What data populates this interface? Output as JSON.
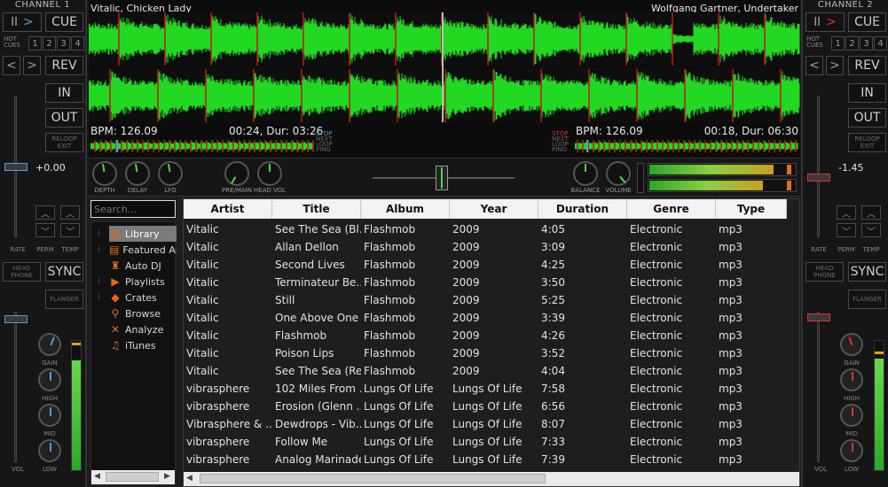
{
  "channels": {
    "left": {
      "title": "CHANNEL 1",
      "play_icon": "II",
      "cue_label": "CUE",
      "hot_label": "HOT\nCUES",
      "hot_cues": [
        "1",
        "2",
        "3",
        "4"
      ],
      "rev_label": "REV",
      "in_label": "IN",
      "out_label": "OUT",
      "reloop_label": "RELOOP\nEXIT",
      "rate_value": "+0.00",
      "rate_label": "RATE",
      "perm_label": "PERM",
      "temp_label": "TEMP",
      "headphone_label": "HEAD\nPHONE",
      "sync_label": "SYNC",
      "flanger_label": "FLANGER",
      "gain_label": "GAIN",
      "high_label": "HIGH",
      "mid_label": "MID",
      "low_label": "LOW",
      "vol_label": "VOL"
    },
    "right": {
      "title": "CHANNEL 2",
      "play_icon": "II",
      "cue_label": "CUE",
      "hot_label": "HOT\nCUES",
      "hot_cues": [
        "1",
        "2",
        "3",
        "4"
      ],
      "rev_label": "REV",
      "in_label": "IN",
      "out_label": "OUT",
      "reloop_label": "RELOOP\nEXIT",
      "rate_value": "-1.45",
      "rate_label": "RATE",
      "perm_label": "PERM",
      "temp_label": "TEMP",
      "headphone_label": "HEAD\nPHONE",
      "sync_label": "SYNC",
      "flanger_label": "FLANGER",
      "gain_label": "GAIN",
      "high_label": "HIGH",
      "mid_label": "MID",
      "low_label": "LOW",
      "vol_label": "VOL"
    }
  },
  "deck1": {
    "track": "Vitalic, Chicken Lady",
    "bpm": "BPM: 126.09",
    "time": "00:24, Dur: 03:26",
    "status": [
      "STOP",
      "NEXT",
      "LOOP",
      "PING"
    ]
  },
  "deck2": {
    "track": "Wolfgang Gartner, Undertaker",
    "bpm": "BPM: 126.09",
    "time": "00:18, Dur: 06:30",
    "status": [
      "STOP",
      "NEXT",
      "LOOP",
      "PING"
    ]
  },
  "mixer": {
    "knobs_left": [
      "DEPTH",
      "DELAY",
      "LFO",
      "PRE/MAIN",
      "HEAD VOL"
    ],
    "knobs_right": [
      "BALANCE",
      "VOLUME"
    ]
  },
  "library": {
    "search_placeholder": "Search...",
    "tree": [
      {
        "label": "Library",
        "icon": "library-icon",
        "glyph": "▥"
      },
      {
        "label": "Featured Artists",
        "icon": "featured-icon",
        "glyph": "▤"
      },
      {
        "label": "Auto DJ",
        "icon": "robot-icon",
        "glyph": "♜"
      },
      {
        "label": "Playlists",
        "icon": "playlist-icon",
        "glyph": "▶"
      },
      {
        "label": "Crates",
        "icon": "crate-icon",
        "glyph": "◆"
      },
      {
        "label": "Browse",
        "icon": "browse-icon",
        "glyph": "⚲"
      },
      {
        "label": "Analyze",
        "icon": "analyze-icon",
        "glyph": "✕"
      },
      {
        "label": "iTunes",
        "icon": "itunes-icon",
        "glyph": "♫"
      }
    ],
    "columns": [
      "Artist",
      "Title",
      "Album",
      "Year",
      "Duration",
      "Genre",
      "Type"
    ],
    "rows": [
      [
        "Vitalic",
        "See The Sea (Bl...",
        "Flashmob",
        "2009",
        "4:05",
        "Electronic",
        "mp3"
      ],
      [
        "Vitalic",
        "Allan Dellon",
        "Flashmob",
        "2009",
        "3:09",
        "Electronic",
        "mp3"
      ],
      [
        "Vitalic",
        "Second Lives",
        "Flashmob",
        "2009",
        "4:25",
        "Electronic",
        "mp3"
      ],
      [
        "Vitalic",
        "Terminateur Be...",
        "Flashmob",
        "2009",
        "3:50",
        "Electronic",
        "mp3"
      ],
      [
        "Vitalic",
        "Still",
        "Flashmob",
        "2009",
        "5:25",
        "Electronic",
        "mp3"
      ],
      [
        "Vitalic",
        "One Above One",
        "Flashmob",
        "2009",
        "3:39",
        "Electronic",
        "mp3"
      ],
      [
        "Vitalic",
        "Flashmob",
        "Flashmob",
        "2009",
        "4:26",
        "Electronic",
        "mp3"
      ],
      [
        "Vitalic",
        "Poison Lips",
        "Flashmob",
        "2009",
        "3:52",
        "Electronic",
        "mp3"
      ],
      [
        "Vitalic",
        "See The Sea (Red)",
        "Flashmob",
        "2009",
        "4:04",
        "Electronic",
        "mp3"
      ],
      [
        "vibrasphere",
        "102 Miles From ...",
        "Lungs Of Life",
        "Lungs Of Life",
        "7:58",
        "Electronic",
        "mp3"
      ],
      [
        "vibrasphere",
        "Erosion (Glenn ...",
        "Lungs Of Life",
        "Lungs Of Life",
        "6:56",
        "Electronic",
        "mp3"
      ],
      [
        "Vibrasphere & ...",
        "Dewdrops - Vib...",
        "Lungs Of Life",
        "Lungs Of Life",
        "8:07",
        "Electronic",
        "mp3"
      ],
      [
        "vibrasphere",
        "Follow Me",
        "Lungs Of Life",
        "Lungs Of Life",
        "7:33",
        "Electronic",
        "mp3"
      ],
      [
        "vibrasphere",
        "Analog Marinade",
        "Lungs Of Life",
        "Lungs Of Life",
        "7:39",
        "Electronic",
        "mp3"
      ]
    ]
  },
  "colors": {
    "waveform": "#22d822",
    "beat_marker": "#c01818",
    "accent_blue": "#4a9fe0",
    "accent_red": "#e03030",
    "tree_icon": "#e06c1a"
  }
}
